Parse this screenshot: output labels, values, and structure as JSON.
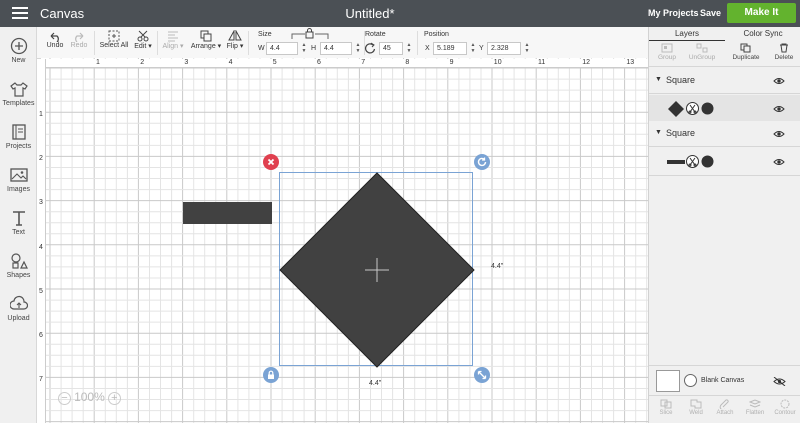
{
  "topbar": {
    "app_title": "Canvas",
    "doc_title": "Untitled*",
    "my_projects": "My Projects",
    "save": "Save",
    "make_it": "Make It"
  },
  "leftbar": [
    {
      "label": "New",
      "icon": "plus-circle-icon"
    },
    {
      "label": "Templates",
      "icon": "shirt-icon"
    },
    {
      "label": "Projects",
      "icon": "book-icon"
    },
    {
      "label": "Images",
      "icon": "image-icon"
    },
    {
      "label": "Text",
      "icon": "text-icon"
    },
    {
      "label": "Shapes",
      "icon": "shapes-icon"
    },
    {
      "label": "Upload",
      "icon": "cloud-upload-icon"
    }
  ],
  "toolbar": {
    "undo": "Undo",
    "redo": "Redo",
    "select_all": "Select All",
    "edit": "Edit ▾",
    "align": "Align ▾",
    "arrange": "Arrange ▾",
    "flip": "Flip ▾",
    "size_label": "Size",
    "w_label": "W",
    "w_value": "4.4",
    "h_label": "H",
    "h_value": "4.4",
    "rotate_label": "Rotate",
    "rotate_value": "45",
    "position_label": "Position",
    "x_label": "X",
    "x_value": "5.189",
    "y_label": "Y",
    "y_value": "2.328"
  },
  "ruler": {
    "top": [
      "1",
      "2",
      "3",
      "4",
      "5",
      "6",
      "7",
      "8",
      "9",
      "10",
      "11",
      "12",
      "13"
    ],
    "left": [
      "1",
      "2",
      "3",
      "4",
      "5",
      "6",
      "7"
    ]
  },
  "canvas": {
    "width_label": "4.4\"",
    "height_label": "4.4\"",
    "zoom": "100%",
    "zoom_minus": "−",
    "zoom_plus": "+"
  },
  "rightpanel": {
    "tab_layers": "Layers",
    "tab_colorsync": "Color Sync",
    "buttons": [
      "Group",
      "UnGroup",
      "Duplicate",
      "Delete"
    ],
    "groups": [
      {
        "name": "Square"
      },
      {
        "name": "Square"
      }
    ],
    "blank_canvas": "Blank Canvas",
    "bottom_buttons": [
      "Slice",
      "Weld",
      "Attach",
      "Flatten",
      "Contour"
    ]
  },
  "colors": {
    "topbar": "#4b5055",
    "make_it": "#63b32e",
    "shape": "#414141",
    "selection": "#7aa3d4",
    "delete_handle": "#e0404f",
    "handle_blue": "#7aa3d4"
  }
}
